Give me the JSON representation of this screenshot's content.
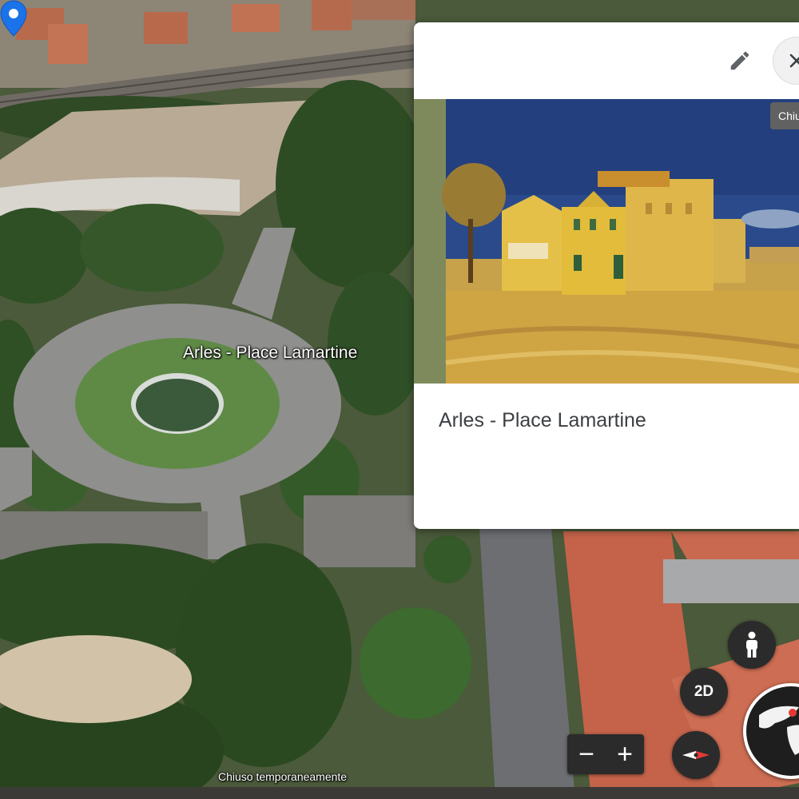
{
  "map": {
    "place_label": "Arles - Place Lamartine",
    "status_text": "Chiuso temporaneamente"
  },
  "card": {
    "title": "Arles - Place Lamartine",
    "image_description": "Van Gogh, The Yellow House",
    "edit_icon": "pencil-icon",
    "close_icon": "close-icon",
    "tooltip": "Chiu"
  },
  "controls": {
    "view_toggle_label": "2D",
    "zoom_out_label": "−",
    "zoom_in_label": "+",
    "pegman_icon": "pegman-icon",
    "compass_icon": "compass-icon",
    "globe_icon": "globe-icon"
  },
  "colors": {
    "pin": "#1a73e8",
    "control_bg": "#2b2b2b",
    "compass_needle": "#e53935"
  }
}
